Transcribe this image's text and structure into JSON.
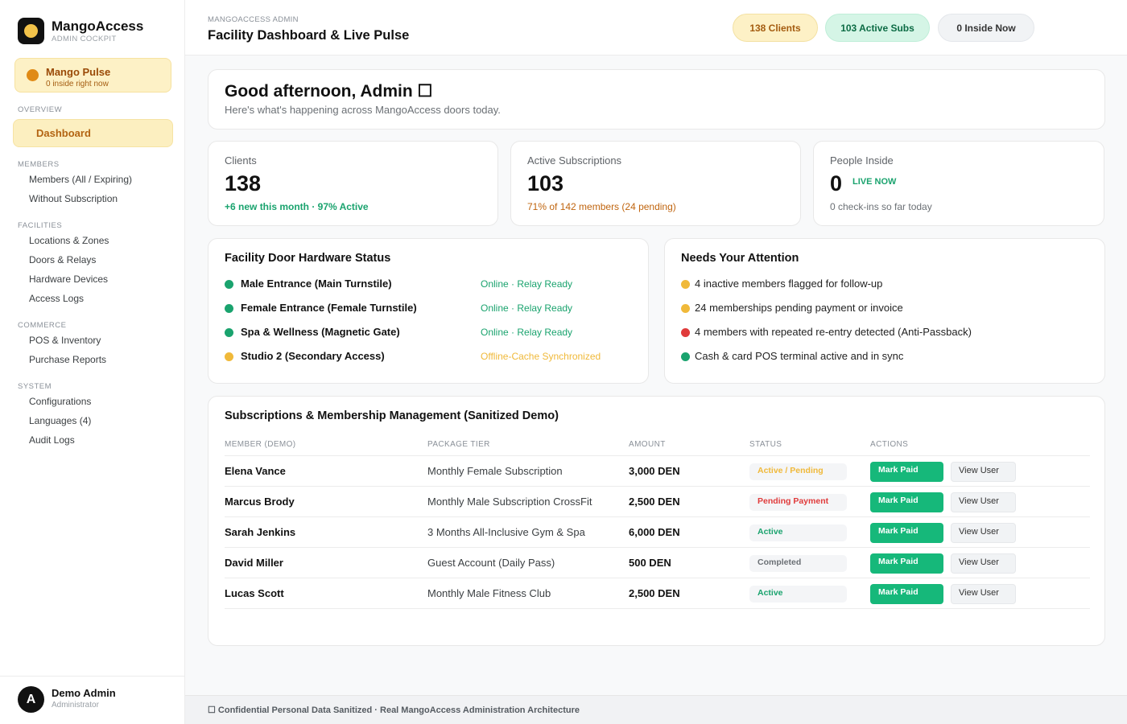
{
  "sidebar": {
    "brand_name": "MangoAccess",
    "brand_sub": "ADMIN COCKPIT",
    "pulse_title": "Mango Pulse",
    "pulse_sub": "0 inside right now",
    "sections": {
      "overview": "OVERVIEW",
      "members": "MEMBERS",
      "facilities": "FACILITIES",
      "commerce": "COMMERCE",
      "system": "SYSTEM"
    },
    "items": {
      "dashboard": "Dashboard",
      "members_all": "Members (All / Expiring)",
      "without_sub": "Without Subscription",
      "locations": "Locations & Zones",
      "doors": "Doors & Relays",
      "hardware": "Hardware Devices",
      "access_logs": "Access Logs",
      "pos": "POS & Inventory",
      "purchase": "Purchase Reports",
      "config": "Configurations",
      "languages": "Languages (4)",
      "audit": "Audit Logs"
    },
    "user": {
      "initial": "A",
      "name": "Demo Admin",
      "role": "Administrator"
    }
  },
  "header": {
    "crumb": "MANGOACCESS ADMIN",
    "title": "Facility Dashboard & Live Pulse",
    "pills": {
      "clients": "138 Clients",
      "subs": "103 Active Subs",
      "inside": "0 Inside Now"
    }
  },
  "greeting": {
    "title": "Good afternoon, Admin ☐",
    "subtitle": "Here's what's happening across MangoAccess doors today."
  },
  "stats": {
    "clients": {
      "label": "Clients",
      "value": "138",
      "foot": "+6 new this month · 97% Active"
    },
    "subs": {
      "label": "Active Subscriptions",
      "value": "103",
      "foot": "71% of 142 members (24 pending)"
    },
    "inside": {
      "label": "People Inside",
      "value": "0",
      "live": "LIVE NOW",
      "foot": "0 check-ins so far today"
    }
  },
  "doors": {
    "title": "Facility Door Hardware Status",
    "rows": [
      {
        "name": "Male Entrance (Main Turnstile)",
        "status": "Online · Relay Ready",
        "color": "#1aa36e"
      },
      {
        "name": "Female Entrance (Female Turnstile)",
        "status": "Online · Relay Ready",
        "color": "#1aa36e"
      },
      {
        "name": "Spa & Wellness (Magnetic Gate)",
        "status": "Online · Relay Ready",
        "color": "#1aa36e"
      },
      {
        "name": "Studio 2 (Secondary Access)",
        "status": "Offline-Cache Synchronized",
        "color": "#f0b93a"
      }
    ]
  },
  "attention": {
    "title": "Needs Your Attention",
    "rows": [
      {
        "text": "4 inactive members flagged for follow-up",
        "color": "#f0b93a"
      },
      {
        "text": "24 memberships pending payment or invoice",
        "color": "#f0b93a"
      },
      {
        "text": "4 members with repeated re-entry detected (Anti-Passback)",
        "color": "#e03b3b"
      },
      {
        "text": "Cash & card POS terminal active and in sync",
        "color": "#1aa36e"
      }
    ]
  },
  "subscriptions": {
    "title": "Subscriptions & Membership Management (Sanitized Demo)",
    "columns": [
      "MEMBER (DEMO)",
      "PACKAGE TIER",
      "AMOUNT",
      "STATUS",
      "ACTIONS"
    ],
    "rows": [
      {
        "name": "Elena Vance",
        "tier": "Monthly Female Subscription",
        "amount": "3,000 DEN",
        "status": "Active / Pending",
        "status_color": "#f0b93a"
      },
      {
        "name": "Marcus Brody",
        "tier": "Monthly Male Subscription CrossFit",
        "amount": "2,500 DEN",
        "status": "Pending Payment",
        "status_color": "#e03b3b"
      },
      {
        "name": "Sarah Jenkins",
        "tier": "3 Months All-Inclusive Gym & Spa",
        "amount": "6,000 DEN",
        "status": "Active",
        "status_color": "#1aa36e"
      },
      {
        "name": "David Miller",
        "tier": "Guest Account (Daily Pass)",
        "amount": "500 DEN",
        "status": "Completed",
        "status_color": "#6b7075"
      },
      {
        "name": "Lucas Scott",
        "tier": "Monthly Male Fitness Club",
        "amount": "2,500 DEN",
        "status": "Active",
        "status_color": "#1aa36e"
      }
    ],
    "mark_paid": "Mark Paid",
    "view_user": "View User"
  },
  "footer": {
    "text": "☐ Confidential Personal Data Sanitized · Real MangoAccess Administration Architecture"
  },
  "colors": {
    "accent": "#16b87a",
    "brand_yellow": "#f3c34a",
    "warning": "#f0b93a",
    "danger": "#e03b3b"
  }
}
